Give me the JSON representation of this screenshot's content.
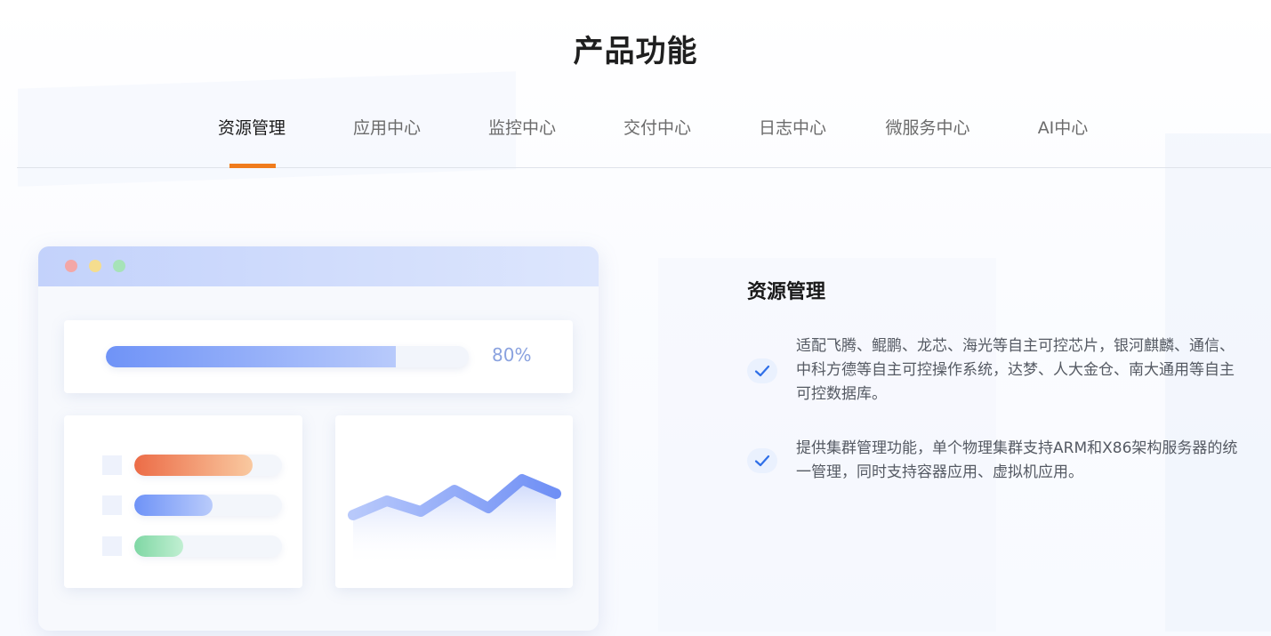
{
  "section_title": "产品功能",
  "tabs": [
    {
      "label": "资源管理",
      "active": true
    },
    {
      "label": "应用中心",
      "active": false
    },
    {
      "label": "监控中心",
      "active": false
    },
    {
      "label": "交付中心",
      "active": false
    },
    {
      "label": "日志中心",
      "active": false
    },
    {
      "label": "微服务中心",
      "active": false
    },
    {
      "label": "AI中心",
      "active": false
    }
  ],
  "illustration": {
    "progress": {
      "value": 0.8,
      "label": "80%"
    },
    "list_bars": [
      {
        "fill": 0.8,
        "color": "orange"
      },
      {
        "fill": 0.53,
        "color": "blue"
      },
      {
        "fill": 0.33,
        "color": "green"
      }
    ],
    "line_series": [
      0.35,
      0.55,
      0.4,
      0.7,
      0.45,
      0.85,
      0.65
    ]
  },
  "content": {
    "title": "资源管理",
    "features": [
      {
        "text": "适配飞腾、鲲鹏、龙芯、海光等自主可控芯片，银河麒麟、通信、中科方德等自主可控操作系统，达梦、人大金仓、南大通用等自主可控数据库。"
      },
      {
        "text": "提供集群管理功能，单个物理集群支持ARM和X86架构服务器的统一管理，同时支持容器应用、虚拟机应用。"
      }
    ]
  },
  "colors": {
    "accent": "#f07c1c",
    "check": "#2f6fe8",
    "progress": "#6f93f7"
  }
}
